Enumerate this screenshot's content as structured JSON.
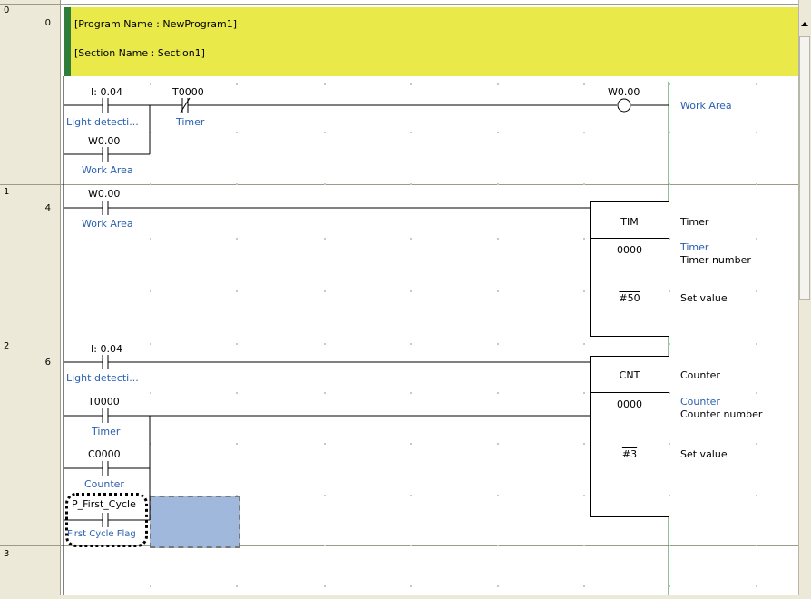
{
  "header": {
    "program_name": "[Program Name : NewProgram1]",
    "section_name": "[Section Name : Section1]"
  },
  "rungs": [
    {
      "rung": "0",
      "step": "0"
    },
    {
      "rung": "1",
      "step": "4"
    },
    {
      "rung": "2",
      "step": "6"
    },
    {
      "rung": "3",
      "step": ""
    }
  ],
  "contacts": {
    "r0_light": {
      "address": "I: 0.04",
      "comment": "Light detecti..."
    },
    "r0_timer": {
      "address": "T0000",
      "comment": "Timer"
    },
    "r0_selfhold": {
      "address": "W0.00",
      "comment": "Work Area"
    },
    "r0_coil": {
      "address": "W0.00",
      "comment": "Work Area"
    },
    "r1_work": {
      "address": "W0.00",
      "comment": "Work Area"
    },
    "r2_light": {
      "address": "I: 0.04",
      "comment": "Light detecti..."
    },
    "r2_timer": {
      "address": "T0000",
      "comment": "Timer"
    },
    "r2_counter": {
      "address": "C0000",
      "comment": "Counter"
    },
    "r2_firstcycle": {
      "address": "P_First_Cycle",
      "comment": "First Cycle Flag"
    }
  },
  "tim_block": {
    "name": "TIM",
    "operand": "0000",
    "setvalue": "#50",
    "label": "Timer",
    "operand_comment": "Timer",
    "operand_desc": "Timer number",
    "setvalue_desc": "Set value"
  },
  "cnt_block": {
    "name": "CNT",
    "operand": "0000",
    "setvalue": "#3",
    "label": "Counter",
    "operand_comment": "Counter",
    "operand_desc": "Counter number",
    "setvalue_desc": "Set value"
  },
  "colors": {
    "header": "#e9e94a",
    "header_strip": "#2f7d3a",
    "comment_text": "#2a60b0",
    "selection": "#9fb8dc",
    "right_rail": "#2f7d3a"
  }
}
